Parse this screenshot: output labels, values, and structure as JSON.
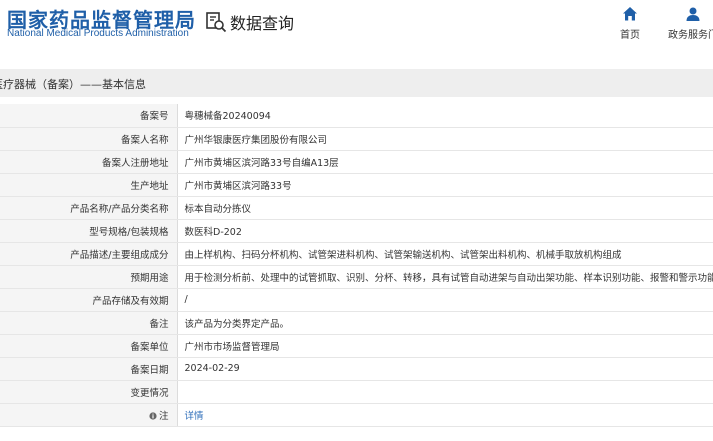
{
  "header": {
    "logo_cn": "国家药品监督管理局",
    "logo_en": "National Medical Products Administration",
    "page_title": "数据查询",
    "nav": [
      {
        "label": "首页",
        "icon": "home-icon"
      },
      {
        "label": "政务服务门",
        "icon": "user-icon"
      }
    ]
  },
  "section": {
    "title": "医疗器械（备案）——基本信息"
  },
  "rows": [
    {
      "label": "备案号",
      "value": "粤穗械备20240094"
    },
    {
      "label": "备案人名称",
      "value": "广州华银康医疗集团股份有限公司"
    },
    {
      "label": "备案人注册地址",
      "value": "广州市黄埔区滨河路33号自编A13层"
    },
    {
      "label": "生产地址",
      "value": "广州市黄埔区滨河路33号"
    },
    {
      "label": "产品名称/产品分类名称",
      "value": "标本自动分拣仪"
    },
    {
      "label": "型号规格/包装规格",
      "value": "数医科D-202"
    },
    {
      "label": "产品描述/主要组成成分",
      "value": "由上样机构、扫码分杯机构、试管架进料机构、试管架输送机构、试管架出料机构、机械手取放机构组成"
    },
    {
      "label": "预期用途",
      "value": "用于检测分析前、处理中的试管抓取、识别、分杯、转移，具有试管自动进架与自动出架功能、样本识别功能、报警和警示功能"
    },
    {
      "label": "产品存储及有效期",
      "value": "/"
    },
    {
      "label": "备注",
      "value": "该产品为分类界定产品。"
    },
    {
      "label": "备案单位",
      "value": "广州市市场监督管理局"
    },
    {
      "label": "备案日期",
      "value": "2024-02-29"
    },
    {
      "label": "变更情况",
      "value": ""
    },
    {
      "label": "注",
      "value": "详情",
      "icon": "info-icon"
    }
  ],
  "colors": {
    "brand": "#1f5fa8",
    "link": "#2b6cb8",
    "label_bg": "#f5f5f5",
    "bar_bg": "#eeeeee"
  }
}
